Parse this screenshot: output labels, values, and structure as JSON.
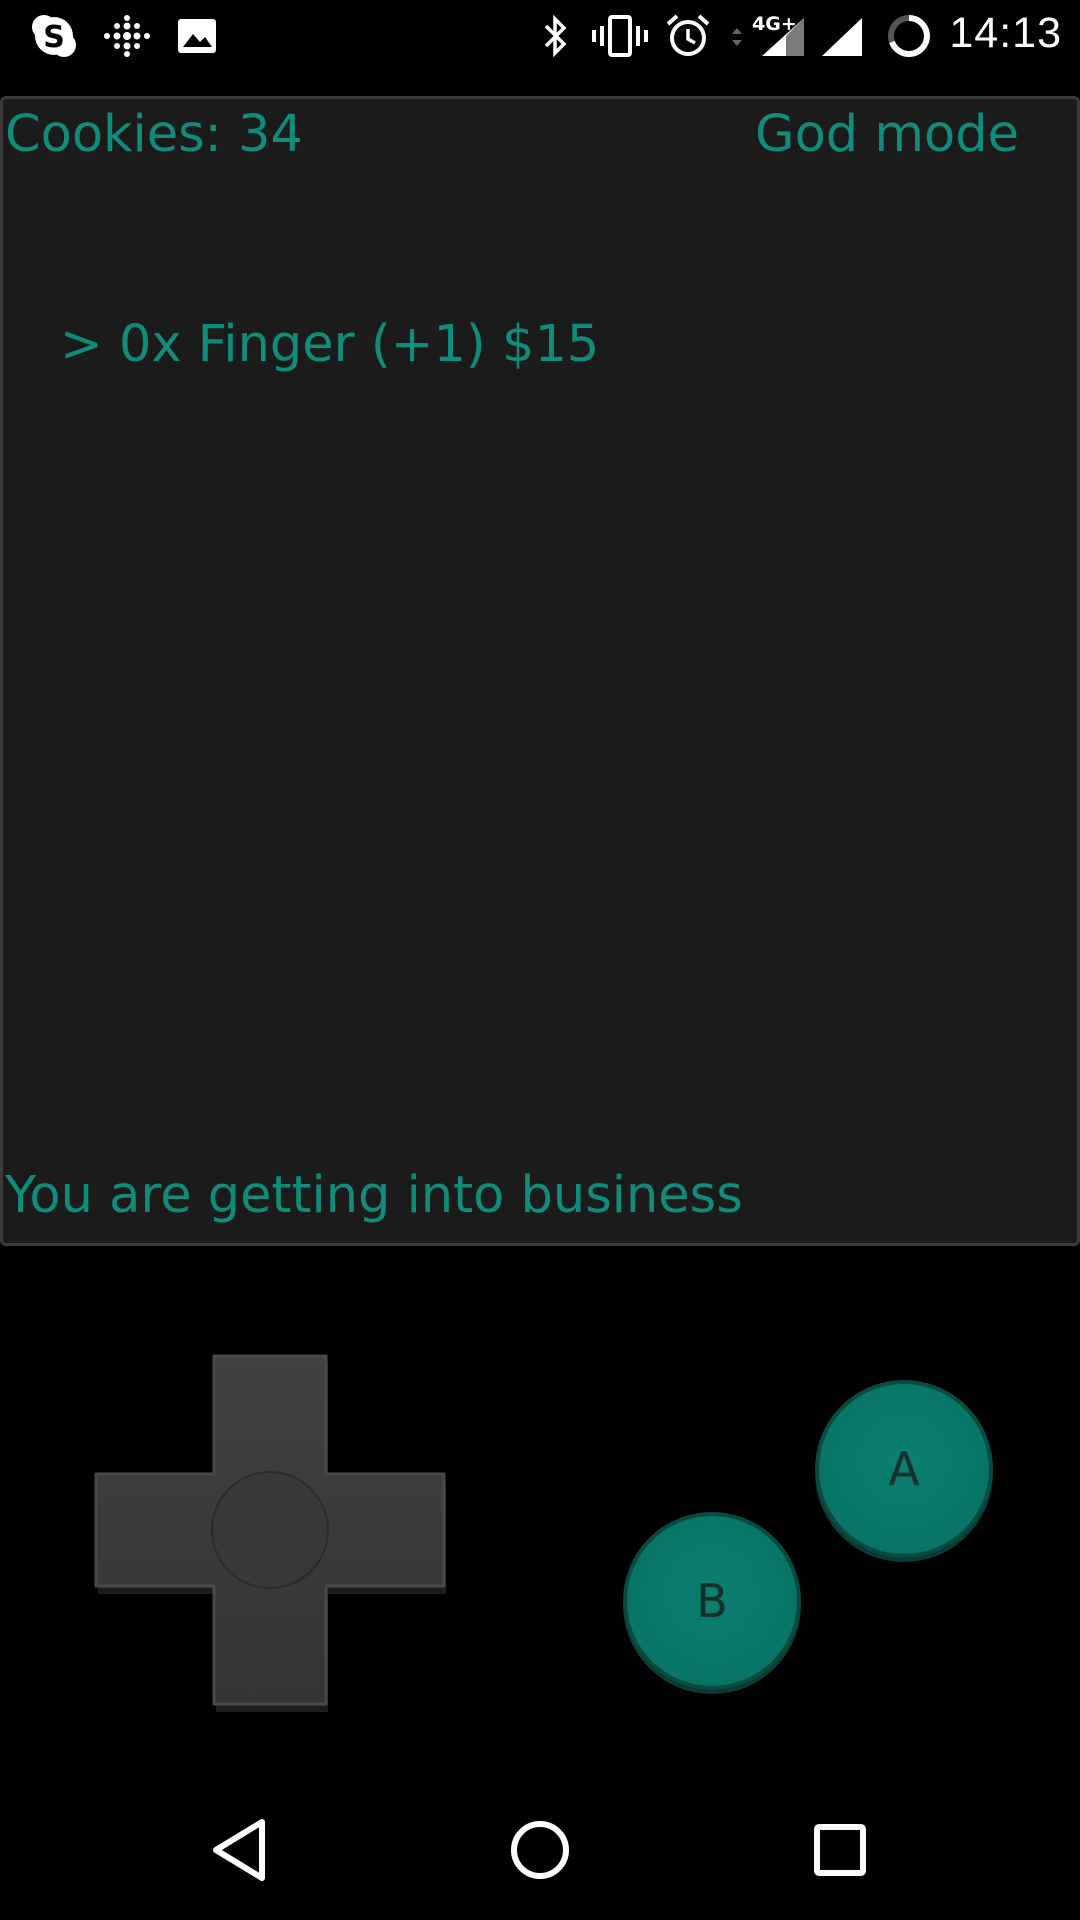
{
  "status_bar": {
    "time": "14:13",
    "network_label": "4G+",
    "left_icons": [
      "skype-icon",
      "fitbit-icon",
      "gallery-icon"
    ],
    "right_icons": [
      "bluetooth-icon",
      "vibrate-icon",
      "alarm-icon",
      "mobile-data-icon",
      "signal-icon",
      "signal-secondary-icon",
      "battery-loading-icon"
    ]
  },
  "game": {
    "cookies_label": "Cookies: 34",
    "mode_label": "God mode",
    "shop_items": [
      "> 0x Finger (+1) $15"
    ],
    "message": "You are getting into business"
  },
  "controller": {
    "a_label": "A",
    "b_label": "B"
  },
  "navigation": {
    "icons": [
      "back-icon",
      "home-icon",
      "recents-icon"
    ]
  },
  "colors": {
    "accent": "#0f8d7c",
    "screen_bg": "#1b1b1b",
    "button": "#087566",
    "dpad": "#3a3a3a"
  }
}
